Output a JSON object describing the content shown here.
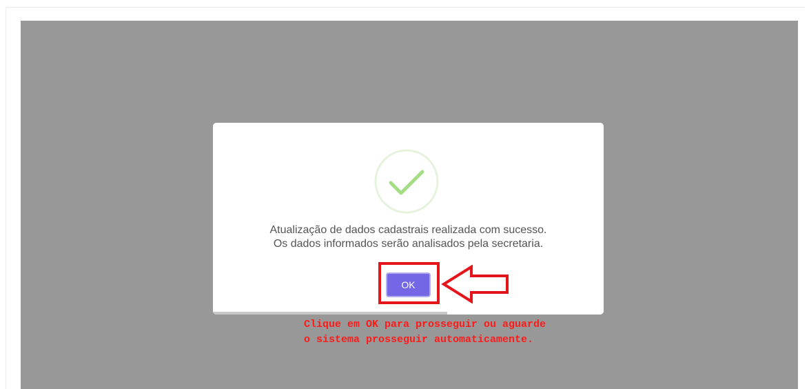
{
  "dialog": {
    "message_line1": "Atualização de dados cadastrais realizada com sucesso.",
    "message_line2": "Os dados informados serão analisados pela secretaria.",
    "ok_label": "OK",
    "icon": "success-check-icon",
    "timer_progress": 0.6
  },
  "annotation": {
    "line1": "Clique em OK para prosseguir ou aguarde",
    "line2": "o sistema prosseguir automaticamente.",
    "highlight_icon": "red-highlight-box",
    "pointer_icon": "left-arrow-icon"
  },
  "colors": {
    "overlay": "#989898",
    "button": "#7367e6",
    "check": "#a5dc86",
    "annotation": "#ff1a1a"
  }
}
